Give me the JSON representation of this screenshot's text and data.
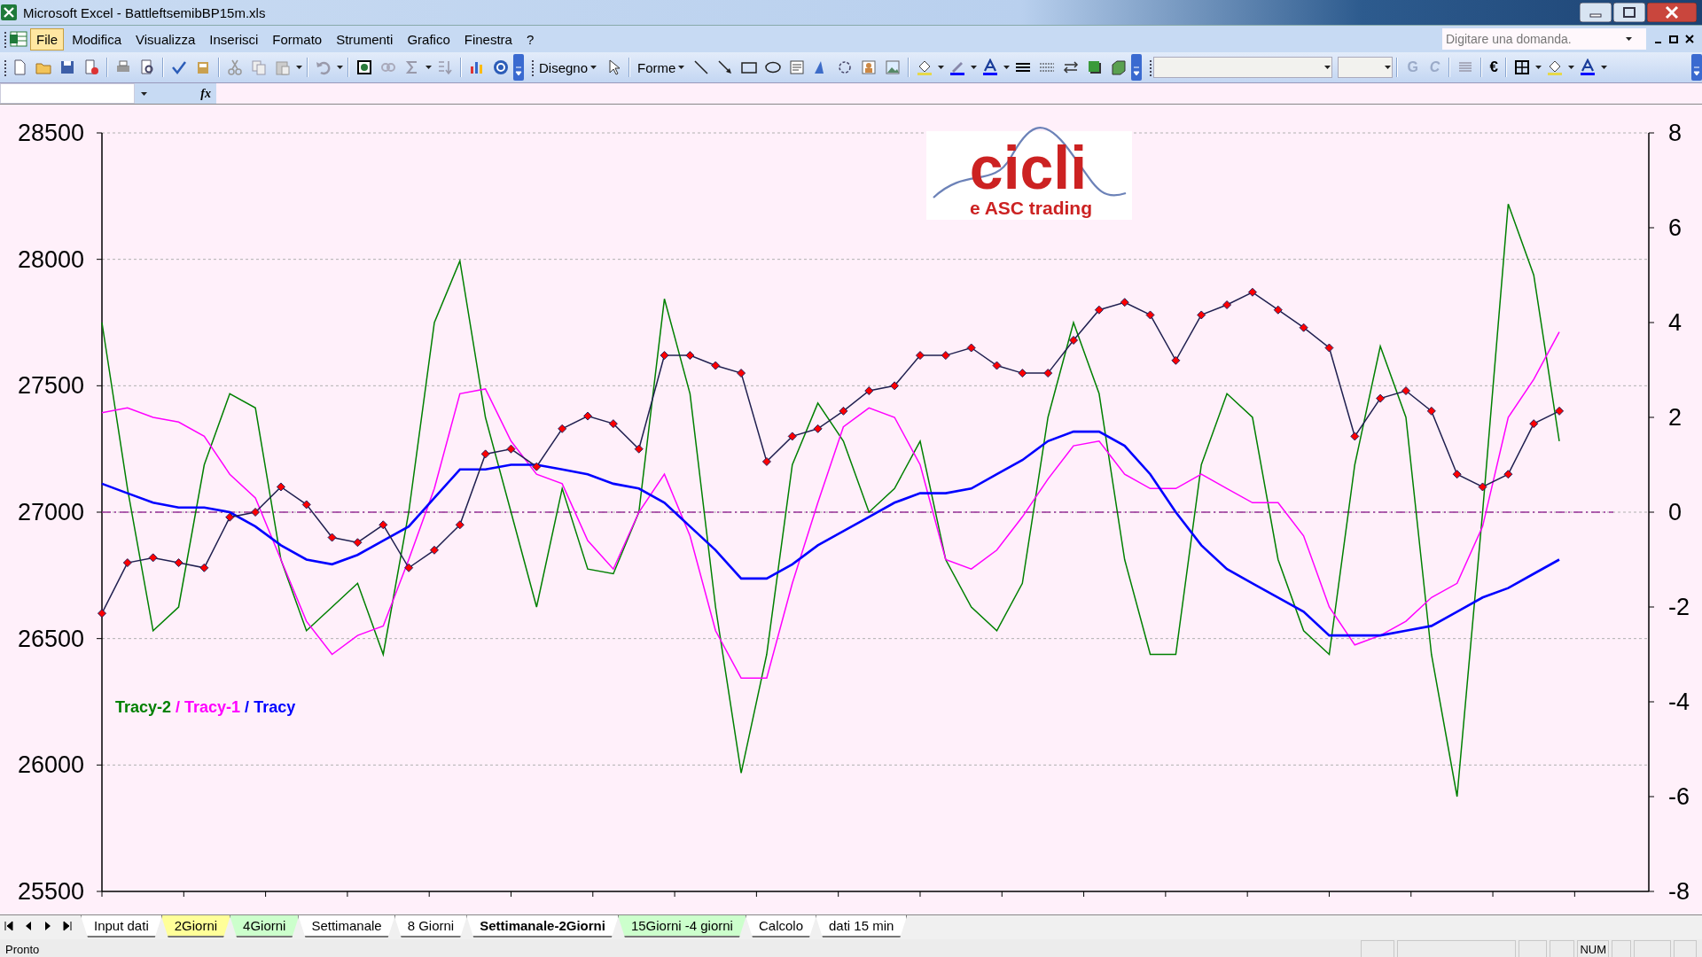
{
  "window": {
    "title": "Microsoft Excel - BattleftsemibBP15m.xls"
  },
  "menu": [
    {
      "label": "File",
      "selected": true
    },
    {
      "label": "Modifica",
      "selected": false
    },
    {
      "label": "Visualizza",
      "selected": false
    },
    {
      "label": "Inserisci",
      "selected": false
    },
    {
      "label": "Formato",
      "selected": false
    },
    {
      "label": "Strumenti",
      "selected": false
    },
    {
      "label": "Grafico",
      "selected": false
    },
    {
      "label": "Finestra",
      "selected": false
    },
    {
      "label": "?",
      "selected": false
    }
  ],
  "help_search": {
    "placeholder": "Digitare una domanda."
  },
  "drawing_toolbar": {
    "draw_menu": "Disegno",
    "shapes_menu": "Forme"
  },
  "format_toolbar": {
    "bold": {
      "label": "G",
      "disabled": true
    },
    "italic": {
      "label": "C",
      "disabled": true
    },
    "currency": "€"
  },
  "formula_bar": {
    "function_label": "fx"
  },
  "chart": {
    "logo": {
      "title": "cicli",
      "subtitle": "e ASC trading"
    },
    "legend_separator": "/",
    "chart_data": {
      "type": "line",
      "ylim": [
        25500,
        28500
      ],
      "yticks": [
        25500,
        26000,
        26500,
        27000,
        27500,
        28000,
        28500
      ],
      "y2lim": [
        -8,
        8
      ],
      "y2ticks": [
        -8,
        -6,
        -4,
        -2,
        0,
        2,
        4,
        6,
        8
      ],
      "grid": true,
      "ref_lines": [
        {
          "value": 0,
          "axis": "y2"
        }
      ],
      "series": [
        {
          "color": "#ff0000",
          "marker": "diamond",
          "values": [
            26600,
            26800,
            26820,
            26800,
            26780,
            26980,
            27000,
            27100,
            27030,
            26900,
            26880,
            26950,
            26780,
            26850,
            26950,
            27230,
            27250,
            27180,
            27330,
            27380,
            27350,
            27250,
            27620,
            27620,
            27580,
            27550,
            27200,
            27300,
            27330,
            27400,
            27480,
            27500,
            27620,
            27620,
            27650,
            27580,
            27550,
            27550,
            27680,
            27800,
            27830,
            27780,
            27600,
            27780,
            27820,
            27870,
            27800,
            27730,
            27650,
            27300,
            27450,
            27480,
            27400,
            27150,
            27100,
            27150,
            27350,
            27400
          ]
        },
        {
          "name": "Tracy-2",
          "axis": "y2",
          "color": "#008000",
          "values": [
            4,
            0.5,
            -2.5,
            -2,
            1,
            2.5,
            2.2,
            -1,
            -2.5,
            -2,
            -1.5,
            -3,
            0,
            4,
            5.3,
            2,
            0,
            -2,
            0.5,
            -1.2,
            -1.3,
            0,
            4.5,
            2.5,
            -2,
            -5.5,
            -3,
            1,
            2.3,
            1.5,
            0,
            0.5,
            1.5,
            -1,
            -2,
            -2.5,
            -1.5,
            2,
            4,
            2.5,
            -1,
            -3,
            -3,
            1,
            2.5,
            2,
            -1,
            -2.5,
            -3,
            1,
            3.5,
            2,
            -3,
            -6,
            0,
            6.5,
            5,
            1.5
          ]
        },
        {
          "name": "Tracy-1",
          "axis": "y2",
          "color": "#ff00ff",
          "values": [
            2.1,
            2.2,
            2,
            1.9,
            1.6,
            0.8,
            0.3,
            -1,
            -2.3,
            -3,
            -2.6,
            -2.4,
            -1,
            0.5,
            2.5,
            2.6,
            1.5,
            0.8,
            0.6,
            -0.6,
            -1.2,
            0,
            0.8,
            -0.5,
            -2.5,
            -3.5,
            -3.5,
            -1.5,
            0.2,
            1.8,
            2.2,
            2,
            1,
            -1,
            -1.2,
            -0.8,
            -0.1,
            0.7,
            1.4,
            1.5,
            0.8,
            0.5,
            0.5,
            0.8,
            0.5,
            0.2,
            0.2,
            -0.5,
            -2,
            -2.8,
            -2.6,
            -2.3,
            -1.8,
            -1.5,
            -0.3,
            2,
            2.8,
            3.8
          ]
        },
        {
          "name": "Tracy",
          "axis": "y2",
          "color": "#0000ff",
          "values": [
            0.6,
            0.4,
            0.2,
            0.1,
            0.1,
            0,
            -0.3,
            -0.7,
            -1,
            -1.1,
            -0.9,
            -0.6,
            -0.3,
            0.3,
            0.9,
            0.9,
            1,
            1,
            0.9,
            0.8,
            0.6,
            0.5,
            0.2,
            -0.3,
            -0.8,
            -1.4,
            -1.4,
            -1.1,
            -0.7,
            -0.4,
            -0.1,
            0.2,
            0.4,
            0.4,
            0.5,
            0.8,
            1.1,
            1.5,
            1.7,
            1.7,
            1.4,
            0.8,
            0,
            -0.7,
            -1.2,
            -1.5,
            -1.8,
            -2.1,
            -2.6,
            -2.6,
            -2.6,
            -2.5,
            -2.4,
            -2.1,
            -1.8,
            -1.6,
            -1.3,
            -1
          ]
        }
      ]
    }
  },
  "sheet_tabs": [
    {
      "label": "Input dati",
      "selected": false,
      "color": "#ffffff"
    },
    {
      "label": "2Giorni",
      "selected": false,
      "color": "#ffff99"
    },
    {
      "label": "4Giorni",
      "selected": false,
      "color": "#ccffcc"
    },
    {
      "label": "Settimanale",
      "selected": false,
      "color": "#ffffff"
    },
    {
      "label": "8 Giorni",
      "selected": false,
      "color": "#ffffff"
    },
    {
      "label": "Settimanale-2Giorni",
      "selected": true,
      "color": "#ffffff"
    },
    {
      "label": "15Giorni -4 giorni",
      "selected": false,
      "color": "#ccffcc"
    },
    {
      "label": "Calcolo",
      "selected": false,
      "color": "#ffffff"
    },
    {
      "label": "dati 15 min",
      "selected": false,
      "color": "#ffffff"
    }
  ],
  "status_bar": {
    "status": "Pronto",
    "indicator": "NUM"
  }
}
